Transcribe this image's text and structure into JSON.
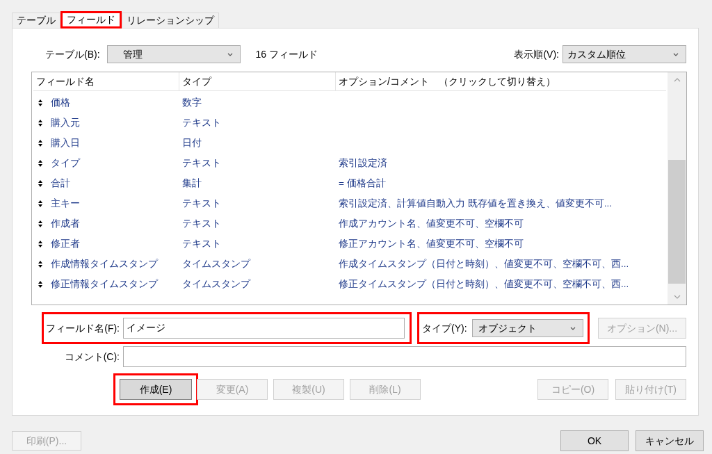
{
  "tabs": [
    {
      "label": "テーブル",
      "selected": false,
      "highlighted": false
    },
    {
      "label": "フィールド",
      "selected": true,
      "highlighted": true
    },
    {
      "label": "リレーションシップ",
      "selected": false,
      "highlighted": false
    }
  ],
  "table_select": {
    "label": "テーブル(B):",
    "value": "管理"
  },
  "field_count": "16 フィールド",
  "sort_select": {
    "label": "表示順(V):",
    "value": "カスタム順位"
  },
  "field_list": {
    "columns": [
      "フィールド名",
      "タイプ",
      "オプション/コメント　（クリックして切り替え）"
    ],
    "rows": [
      {
        "name": "価格",
        "type": "数字"
      },
      {
        "name": "購入元",
        "type": "テキスト"
      },
      {
        "name": "購入日",
        "type": "日付"
      },
      {
        "name": "タイプ",
        "type": "テキスト",
        "options": "索引設定済"
      },
      {
        "name": "合計",
        "type": "集計",
        "options": "= 価格合計"
      },
      {
        "name": "主キー",
        "type": "テキスト",
        "options": "索引設定済、計算値自動入力 既存値を置き換え、値変更不可..."
      },
      {
        "name": "作成者",
        "type": "テキスト",
        "options": "作成アカウント名、値変更不可、空欄不可"
      },
      {
        "name": "修正者",
        "type": "テキスト",
        "options": "修正アカウント名、値変更不可、空欄不可"
      },
      {
        "name": "作成情報タイムスタンプ",
        "type": "タイムスタンプ",
        "options": "作成タイムスタンプ（日付と時刻）、値変更不可、空欄不可、西..."
      },
      {
        "name": "修正情報タイムスタンプ",
        "type": "タイムスタンプ",
        "options": "修正タイムスタンプ（日付と時刻）、値変更不可、空欄不可、西..."
      }
    ]
  },
  "field_name": {
    "label": "フィールド名(F):",
    "value": "イメージ",
    "highlighted": true
  },
  "field_type": {
    "label": "タイプ(Y):",
    "value": "オブジェクト",
    "highlighted": true
  },
  "options_button": {
    "label": "オプション(N)...",
    "disabled": true
  },
  "comment": {
    "label": "コメント(C):"
  },
  "action_buttons": [
    {
      "label": "作成(E)",
      "disabled": false,
      "highlighted": true
    },
    {
      "label": "変更(A)",
      "disabled": true,
      "highlighted": false
    },
    {
      "label": "複製(U)",
      "disabled": true,
      "highlighted": false
    },
    {
      "label": "削除(L)",
      "disabled": true,
      "highlighted": false
    }
  ],
  "clipboard_buttons": [
    {
      "label": "コピー(O)",
      "disabled": true
    },
    {
      "label": "貼り付け(T)",
      "disabled": true
    }
  ],
  "print_button": {
    "label": "印刷(P)...",
    "disabled": true
  },
  "dialog_buttons": [
    {
      "label": "OK",
      "disabled": false
    },
    {
      "label": "キャンセル",
      "disabled": false
    }
  ]
}
